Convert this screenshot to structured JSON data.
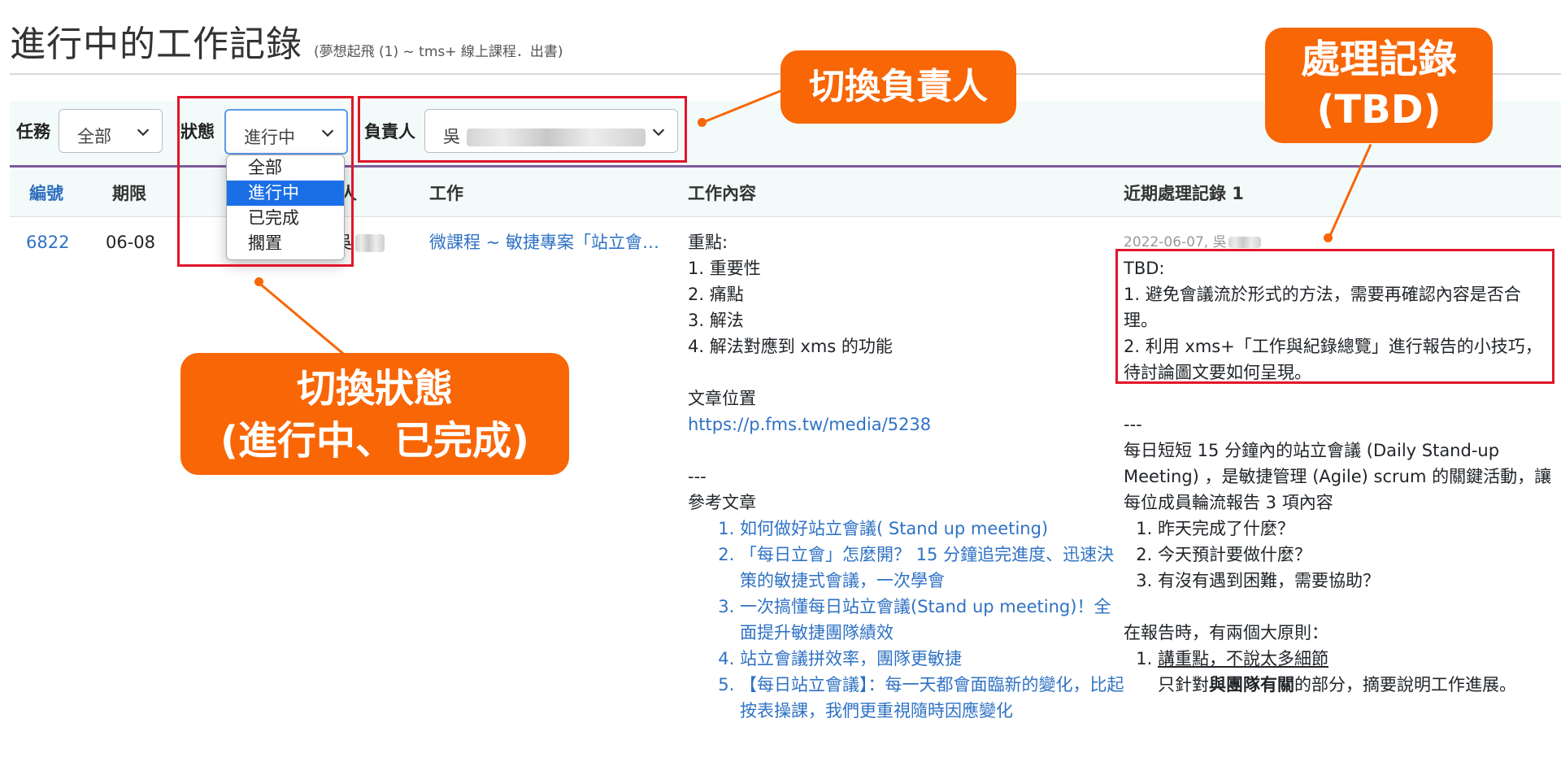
{
  "page": {
    "title": "進行中的工作記錄",
    "subtitle": "(夢想起飛 (1) ~ tms+ 線上課程．出書)"
  },
  "filters": {
    "task_label": "任務",
    "task_value": "全部",
    "status_label": "狀態",
    "status_value": "進行中",
    "owner_label": "負責人",
    "owner_value": "吳"
  },
  "status_dropdown": {
    "options": [
      "全部",
      "進行中",
      "已完成",
      "擱置"
    ],
    "selected": "進行中"
  },
  "table": {
    "headers": [
      "編號",
      "期限",
      "負責人",
      "工作",
      "工作內容",
      "近期處理記錄 1"
    ],
    "row": {
      "id": "6822",
      "deadline": "06-08",
      "owner": "吳",
      "work": "微課程 ~ 敏捷專案「站立會議」",
      "content": {
        "key_points_title": "重點:",
        "key_points": [
          "1. 重要性",
          "2. 痛點",
          "3. 解法",
          "4. 解法對應到 xms 的功能"
        ],
        "location_title": "文章位置",
        "location_url": "https://p.fms.tw/media/5238",
        "separator": "---",
        "refs_title": "參考文章",
        "refs": [
          "如何做好站立會議( Stand up meeting)",
          "「每日立會」怎麼開？ 15 分鐘追完進度、迅速決策的敏捷式會議，一次學會",
          "一次搞懂每日站立會議(Stand up meeting)！全面提升敏捷團隊績效",
          "站立會議拼效率，團隊更敏捷",
          "【每日站立會議】：每一天都會面臨新的變化，比起按表操課，我們更重視隨時因應變化"
        ]
      },
      "record": {
        "meta": "2022-06-07, 吳",
        "tbd_title": "TBD:",
        "tbd_1": "1. 避免會議流於形式的方法，需要再確認內容是否合理。",
        "tbd_2": "2. 利用 xms+「工作與紀錄總覽」進行報告的小技巧，待討論圖文要如何呈現。",
        "separator": "---",
        "intro": "每日短短 15 分鐘內的站立會議 (Daily Stand-up Meeting) ，是敏捷管理 (Agile) scrum 的關鍵活動，讓每位成員輪流報告 3 項內容",
        "questions": [
          "昨天完成了什麼？",
          "今天預計要做什麼？",
          "有沒有遇到困難，需要協助？"
        ],
        "principles_title": "在報告時，有兩個大原則：",
        "principle_1": "講重點，不說太多細節",
        "principle_1_desc_a": "只針對",
        "principle_1_desc_b": "與團隊有關",
        "principle_1_desc_c": "的部分，摘要說明工作進展。"
      }
    }
  },
  "callouts": {
    "switch_owner": "切換負責人",
    "record_line1": "處理記錄",
    "record_line2": "(TBD)",
    "status_line1": "切換狀態",
    "status_line2": "(進行中、已完成)"
  },
  "colors": {
    "accent_orange": "#f86606",
    "highlight_red": "#e0162a",
    "link_blue": "#2f72c4",
    "header_bg": "#f2fbfa",
    "selected_option": "#1b6fe6"
  }
}
